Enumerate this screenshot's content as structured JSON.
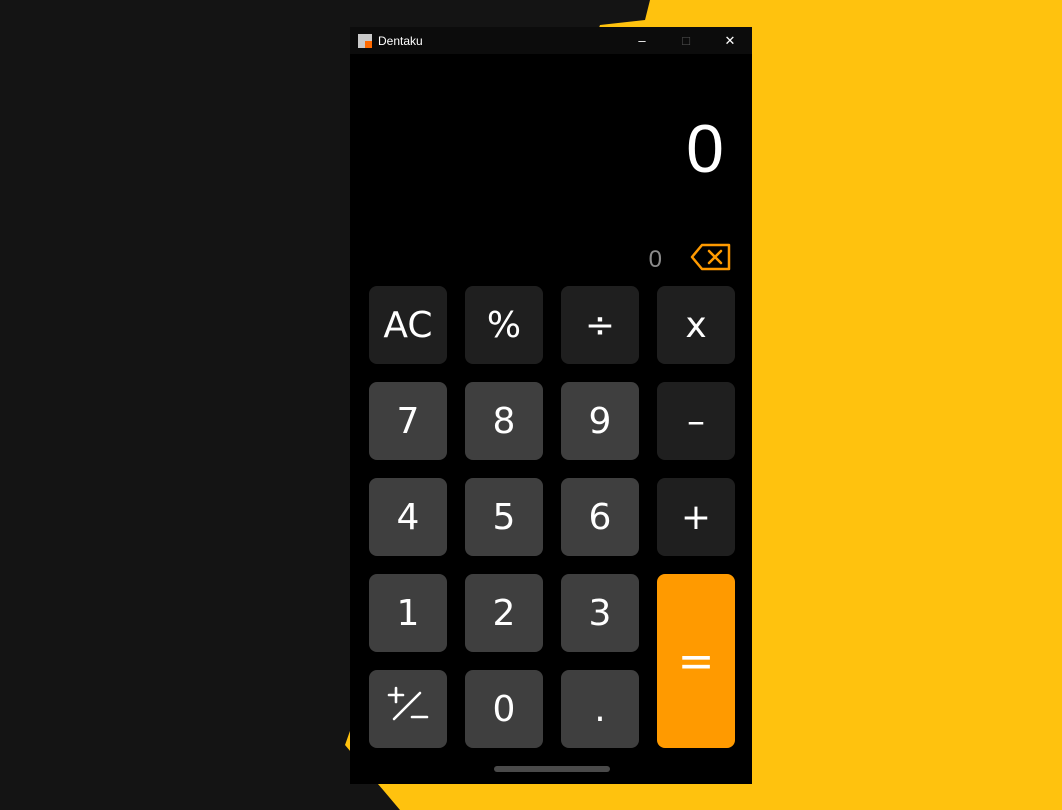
{
  "window": {
    "title": "Dentaku",
    "minimize_glyph": "–",
    "maximize_glyph": "□",
    "close_glyph": "✕"
  },
  "display": {
    "value": "0",
    "history": "0"
  },
  "keys": {
    "ac": "AC",
    "percent": "%",
    "divide": "÷",
    "multiply": "x",
    "seven": "7",
    "eight": "8",
    "nine": "9",
    "minus": "–",
    "four": "4",
    "five": "5",
    "six": "6",
    "plus": "+",
    "one": "1",
    "two": "2",
    "three": "3",
    "equals": "=",
    "zero": "0",
    "decimal": "."
  },
  "icons": {
    "backspace": "backspace-icon",
    "plus_minus": "plus-minus-icon",
    "app": "dentaku-app-icon"
  },
  "colors": {
    "accent": "#FF9A00",
    "background_yellow": "#FFC20E",
    "operator_key": "#1F1F1F",
    "digit_key": "#3F3F3F"
  }
}
